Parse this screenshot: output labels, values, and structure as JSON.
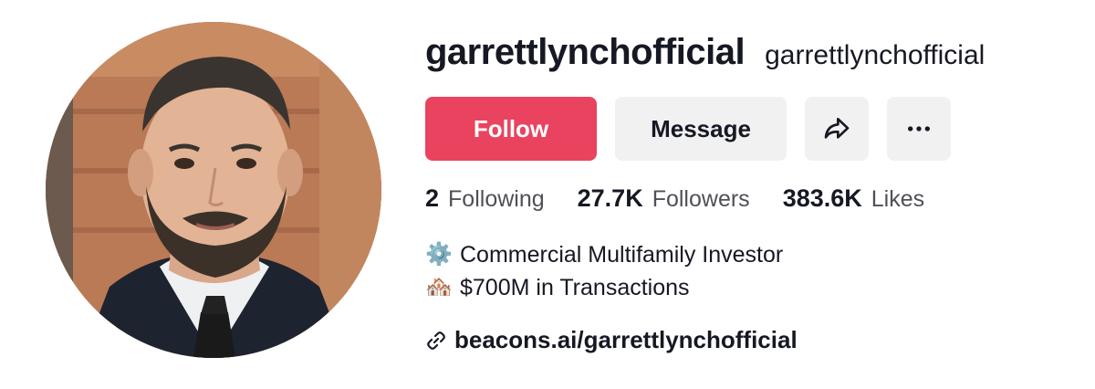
{
  "profile": {
    "username": "garrettlynchofficial",
    "nickname": "garrettlynchofficial"
  },
  "actions": {
    "follow_label": "Follow",
    "message_label": "Message",
    "share_icon": "share-arrow-icon",
    "more_icon": "more-dots-icon"
  },
  "stats": [
    {
      "value": "2",
      "label": "Following"
    },
    {
      "value": "27.7K",
      "label": "Followers"
    },
    {
      "value": "383.6K",
      "label": "Likes"
    }
  ],
  "bio": [
    {
      "emoji": "⚙️",
      "text": "Commercial Multifamily Investor"
    },
    {
      "emoji": "🏘️",
      "text": "$700M in Transactions"
    }
  ],
  "link": {
    "text": "beacons.ai/garrettlynchofficial",
    "icon": "link-icon"
  },
  "colors": {
    "follow": "#ea435f",
    "button_bg": "#f1f1f2",
    "text": "#161823",
    "muted": "#4f5058"
  }
}
